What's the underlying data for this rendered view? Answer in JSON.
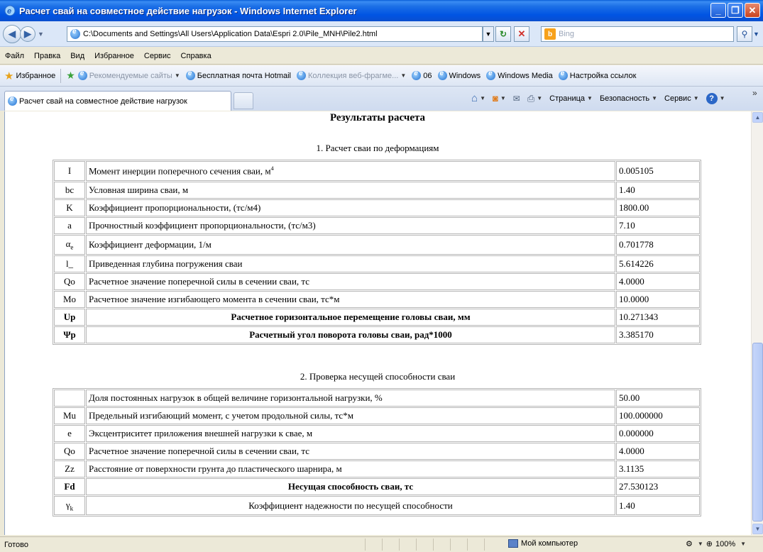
{
  "window": {
    "title": "Расчет свай на совместное действие нагрузок - Windows Internet Explorer",
    "minimize": "_",
    "maximize": "❐",
    "close": "✕"
  },
  "address_bar": {
    "url": "C:\\Documents and Settings\\All Users\\Application Data\\Espri 2.0\\Pile_MNH\\Pile2.html",
    "search_placeholder": "Bing"
  },
  "menu": [
    "Файл",
    "Правка",
    "Вид",
    "Избранное",
    "Сервис",
    "Справка"
  ],
  "favorites": {
    "label": "Избранное",
    "items": [
      "Рекомендуемые сайты",
      "Бесплатная почта Hotmail",
      "Коллекция веб-фрагме...",
      "06",
      "Windows",
      "Windows Media",
      "Настройка ссылок"
    ]
  },
  "tab": {
    "title": "Расчет свай на совместное действие нагрузок"
  },
  "commands": {
    "page": "Страница",
    "safety": "Безопасность",
    "tools": "Сервис"
  },
  "content": {
    "title": "Результаты расчета",
    "section1": {
      "title": "1. Расчет сваи по деформациям",
      "rows": [
        {
          "sym": "I",
          "desc": "Момент инерции поперечного сечения сваи, м",
          "desc_sup": "4",
          "val": "0.005105"
        },
        {
          "sym": "bc",
          "desc": "Условная ширина сваи, м",
          "val": "1.40"
        },
        {
          "sym": "K",
          "desc": "Коэффициент пропорциональности, (тс/м4)",
          "val": "1800.00"
        },
        {
          "sym": "a",
          "desc": "Прочностный коэффициент пропорциональности, (тс/м3)",
          "val": "7.10"
        },
        {
          "sym": "α",
          "sym_sub": "e",
          "desc": "Коэффициент деформации, 1/м",
          "val": "0.701778"
        },
        {
          "sym": "l_",
          "desc": "Приведенная глубина погружения сваи",
          "val": "5.614226"
        },
        {
          "sym": "Qo",
          "desc": "Расчетное значение поперечной силы в сечении сваи, тс",
          "val": "4.0000"
        },
        {
          "sym": "Mo",
          "desc": "Расчетное значение изгибающего момента в сечении сваи, тс*м",
          "val": "10.0000"
        },
        {
          "sym": "Up",
          "desc": "Расчетное горизонтальное перемещение головы сваи, мм",
          "val": "10.271343",
          "bold": true
        },
        {
          "sym": "Ψp",
          "desc": "Расчетный угол поворота головы сваи, рад*1000",
          "val": "3.385170",
          "bold": true
        }
      ]
    },
    "section2": {
      "title": "2. Проверка несущей способности сваи",
      "rows": [
        {
          "sym": "",
          "desc": "Доля постоянных нагрузок в общей величине горизонтальной нагрузки, %",
          "val": "50.00"
        },
        {
          "sym": "Mu",
          "desc": "Предельный изгибающий момент, с учетом продольной силы, тс*м",
          "val": "100.000000"
        },
        {
          "sym": "e",
          "desc": "Эксцентриситет приложения внешней нагрузки к свае, м",
          "val": "0.000000"
        },
        {
          "sym": "Qo",
          "desc": "Расчетное значение поперечной силы в сечении сваи, тс",
          "val": "4.0000"
        },
        {
          "sym": "Zz",
          "desc": "Расстояние от поверхности грунта до пластического шарнира, м",
          "val": "3.1135"
        },
        {
          "sym": "Fd",
          "desc": "Несущая способность сваи, тс",
          "val": "27.530123",
          "bold": true
        },
        {
          "sym": "γ",
          "sym_sub": "k",
          "desc": "Коэффициент надежности по несущей способности",
          "val": "1.40",
          "center": true
        }
      ]
    }
  },
  "status": {
    "text": "Готово",
    "zone": "Мой компьютер",
    "zoom": "100%"
  }
}
